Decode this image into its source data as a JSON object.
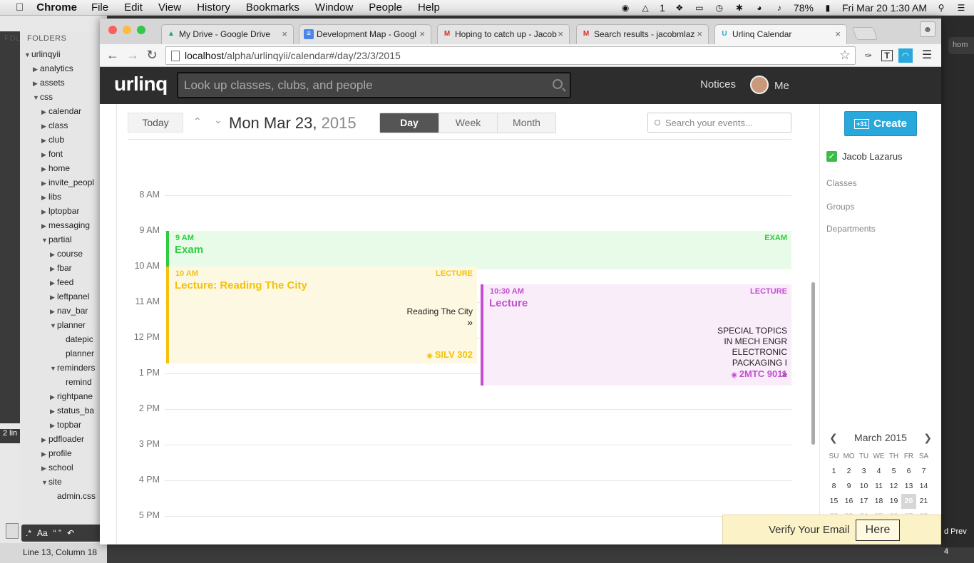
{
  "menubar": {
    "app": "Chrome",
    "items": [
      "File",
      "Edit",
      "View",
      "History",
      "Bookmarks",
      "Window",
      "People",
      "Help"
    ],
    "ai_count": "1",
    "battery": "78%",
    "clock": "Fri Mar 20  1:30 AM"
  },
  "editor": {
    "folders_label": "FOLDERS",
    "fol_label": "FOL",
    "tree": [
      {
        "label": "urlinqyii",
        "indent": 0,
        "open": true
      },
      {
        "label": "analytics",
        "indent": 1,
        "open": false
      },
      {
        "label": "assets",
        "indent": 1,
        "open": false
      },
      {
        "label": "css",
        "indent": 1,
        "open": true
      },
      {
        "label": "calendar",
        "indent": 2,
        "open": false
      },
      {
        "label": "class",
        "indent": 2,
        "open": false
      },
      {
        "label": "club",
        "indent": 2,
        "open": false
      },
      {
        "label": "font",
        "indent": 2,
        "open": false
      },
      {
        "label": "home",
        "indent": 2,
        "open": false
      },
      {
        "label": "invite_peopl",
        "indent": 2,
        "open": false
      },
      {
        "label": "libs",
        "indent": 2,
        "open": false
      },
      {
        "label": "lptopbar",
        "indent": 2,
        "open": false
      },
      {
        "label": "messaging",
        "indent": 2,
        "open": false
      },
      {
        "label": "partial",
        "indent": 2,
        "open": true
      },
      {
        "label": "course",
        "indent": 3,
        "open": false
      },
      {
        "label": "fbar",
        "indent": 3,
        "open": false
      },
      {
        "label": "feed",
        "indent": 3,
        "open": false
      },
      {
        "label": "leftpanel",
        "indent": 3,
        "open": false
      },
      {
        "label": "nav_bar",
        "indent": 3,
        "open": false
      },
      {
        "label": "planner",
        "indent": 3,
        "open": true
      },
      {
        "label": "datepic",
        "indent": 4,
        "open": null
      },
      {
        "label": "planner",
        "indent": 4,
        "open": null
      },
      {
        "label": "reminders",
        "indent": 3,
        "open": true
      },
      {
        "label": "remind",
        "indent": 4,
        "open": null
      },
      {
        "label": "rightpane",
        "indent": 3,
        "open": false
      },
      {
        "label": "status_ba",
        "indent": 3,
        "open": false
      },
      {
        "label": "topbar",
        "indent": 3,
        "open": false
      },
      {
        "label": "pdfloader",
        "indent": 2,
        "open": false
      },
      {
        "label": "profile",
        "indent": 2,
        "open": false
      },
      {
        "label": "school",
        "indent": 2,
        "open": false
      },
      {
        "label": "site",
        "indent": 2,
        "open": true
      },
      {
        "label": "admin.css",
        "indent": 3,
        "open": null
      }
    ],
    "status": "Line 13, Column 18",
    "mini_label": "2 lin",
    "aa_label": "Aa",
    "quote_label": "“ ”",
    "right_pill": "hom",
    "right_prev": "d Prev",
    "right_num": "4"
  },
  "browser": {
    "tabs": [
      {
        "title": "My Drive - Google Drive",
        "icon": "drive-icon",
        "color": "#1fa463"
      },
      {
        "title": "Development Map - Googl",
        "icon": "docs-icon",
        "color": "#4a86e8"
      },
      {
        "title": "Hoping to catch up - Jacob",
        "icon": "gmail-icon",
        "color": "#d93025"
      },
      {
        "title": "Search results - jacobmlaz",
        "icon": "gmail-icon",
        "color": "#d93025"
      },
      {
        "title": "Urlinq Calendar",
        "icon": "urlinq-icon",
        "color": "#29a8dc"
      }
    ],
    "url_host": "localhost",
    "url_path": "/alpha/urlinqyii/calendar#/day/23/3/2015"
  },
  "urlinq": {
    "logo": "urlinq",
    "search_placeholder": "Look up classes, clubs, and people",
    "notices": "Notices",
    "me": "Me"
  },
  "calendar": {
    "today": "Today",
    "date_main": "Mon Mar 23,",
    "date_year": "2015",
    "views": [
      "Day",
      "Week",
      "Month"
    ],
    "selected_view": "Day",
    "search_placeholder": "Search your events...",
    "hours": [
      "8 AM",
      "9 AM",
      "10 AM",
      "11 AM",
      "12 PM",
      "1 PM",
      "2 PM",
      "3 PM",
      "4 PM",
      "5 PM"
    ],
    "events": [
      {
        "time": "9 AM",
        "type": "EXAM",
        "title": "Exam",
        "desc": "",
        "more": false,
        "location": "",
        "color": "#2ecc40",
        "bg": "#e8fbe9"
      },
      {
        "time": "10 AM",
        "type": "LECTURE",
        "title": "Lecture: Reading The City",
        "desc": "Reading The City",
        "more": true,
        "location": "SILV 302",
        "color": "#f4c20d",
        "bg": "#fdf8e1"
      },
      {
        "time": "10:30 AM",
        "type": "LECTURE",
        "title": "Lecture",
        "desc": "SPECIAL TOPICS IN MECH ENGR ELECTRONIC PACKAGING I",
        "more": true,
        "location": "2MTC 9011",
        "color": "#c44fd0",
        "bg": "#f9edfa"
      }
    ]
  },
  "sidebar": {
    "create": "Create",
    "calendar_owner": "Jacob Lazarus",
    "links": [
      "Classes",
      "Groups",
      "Departments"
    ],
    "month": "March 2015",
    "weekdays": [
      "SU",
      "MO",
      "TU",
      "WE",
      "TH",
      "FR",
      "SA"
    ],
    "days": [
      "1",
      "2",
      "3",
      "4",
      "5",
      "6",
      "7",
      "8",
      "9",
      "10",
      "11",
      "12",
      "13",
      "14",
      "15",
      "16",
      "17",
      "18",
      "19",
      "20",
      "21",
      "22",
      "23",
      "24",
      "25",
      "26",
      "27",
      "28"
    ],
    "current_day": "20"
  },
  "verify": {
    "text": "Verify Your Email",
    "button": "Here"
  }
}
